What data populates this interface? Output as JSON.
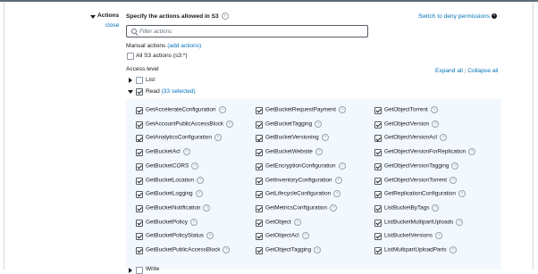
{
  "actions_section": {
    "label": "Actions",
    "close_label": "close",
    "title": "Specify the actions allowed in S3",
    "switch_label": "Switch to deny permissions",
    "filter_placeholder": "Filter actions",
    "manual_title": "Manual actions",
    "add_actions_label": "(add actions)",
    "all_s3_label": "All S3 actions (s3:*)",
    "access_level_label": "Access level",
    "expand_all": "Expand all",
    "collapse_all": "Collapse all",
    "separator": "|",
    "list_label": "List",
    "read_label": "Read",
    "read_count": "(33 selected)",
    "write_label": "Write"
  },
  "read_permissions": {
    "col1": [
      "GetAccelerateConfiguration",
      "GetAccountPublicAccessBlock",
      "GetAnalyticsConfiguration",
      "GetBucketAcl",
      "GetBucketCORS",
      "GetBucketLocation",
      "GetBucketLogging",
      "GetBucketNotification",
      "GetBucketPolicy",
      "GetBucketPolicyStatus",
      "GetBucketPublicAccessBlock"
    ],
    "col2": [
      "GetBucketRequestPayment",
      "GetBucketTagging",
      "GetBucketVersioning",
      "GetBucketWebsite",
      "GetEncryptionConfiguration",
      "GetInventoryConfiguration",
      "GetLifecycleConfiguration",
      "GetMetricsConfiguration",
      "GetObject",
      "GetObjectAcl",
      "GetObjectTagging"
    ],
    "col3": [
      "GetObjectTorrent",
      "GetObjectVersion",
      "GetObjectVersionAcl",
      "GetObjectVersionForReplication",
      "GetObjectVersionTagging",
      "GetObjectVersionTorrent",
      "GetReplicationConfiguration",
      "ListBucketByTags",
      "ListBucketMultipartUploads",
      "ListBucketVersions",
      "ListMultipartUploadParts"
    ]
  },
  "icons": {
    "help": "question-circle-icon",
    "info": "info-circle-icon",
    "search": "search-icon"
  },
  "colors": {
    "link": "#0073bb",
    "panel": "#f2f8fd",
    "text": "#16191f"
  }
}
